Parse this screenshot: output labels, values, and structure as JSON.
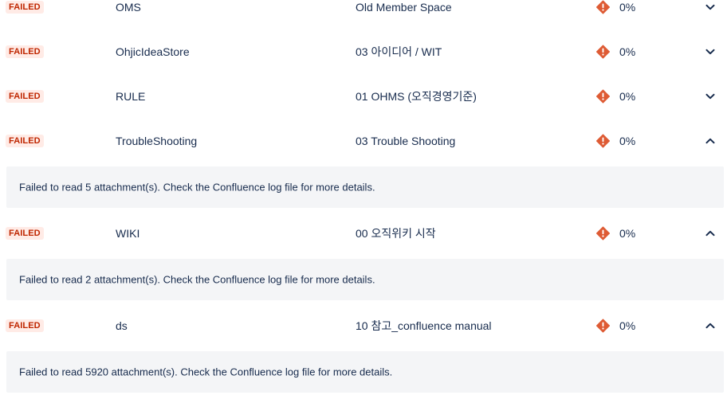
{
  "status_label": "FAILED",
  "colors": {
    "badge_bg": "#ffebe6",
    "badge_text": "#bf2600",
    "warning_icon": "#de5b34",
    "detail_bg": "#f4f5f7"
  },
  "rows": [
    {
      "status": "FAILED",
      "key": "OMS",
      "name": "Old Member Space",
      "progress": "0%",
      "expanded": false
    },
    {
      "status": "FAILED",
      "key": "OhjicIdeaStore",
      "name": "03 아이디어 / WIT",
      "progress": "0%",
      "expanded": false
    },
    {
      "status": "FAILED",
      "key": "RULE",
      "name": "01 OHMS (오직경영기준)",
      "progress": "0%",
      "expanded": false
    },
    {
      "status": "FAILED",
      "key": "TroubleShooting",
      "name": "03 Trouble Shooting",
      "progress": "0%",
      "expanded": true,
      "detail": "Failed to read 5 attachment(s). Check the Confluence log file for more details."
    },
    {
      "status": "FAILED",
      "key": "WIKI",
      "name": "00 오직위키 시작",
      "progress": "0%",
      "expanded": true,
      "detail": "Failed to read 2 attachment(s). Check the Confluence log file for more details."
    },
    {
      "status": "FAILED",
      "key": "ds",
      "name": "10 참고_confluence manual",
      "progress": "0%",
      "expanded": true,
      "detail": "Failed to read 5920 attachment(s). Check the Confluence log file for more details."
    }
  ]
}
